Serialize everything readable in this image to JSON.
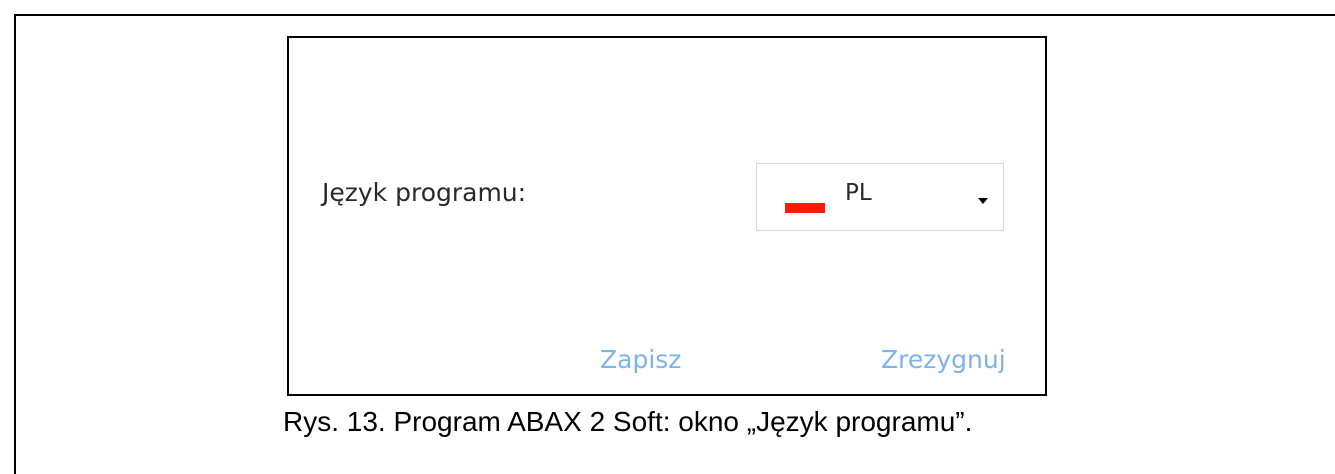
{
  "dialog": {
    "language_label": "Język programu:",
    "language_select": {
      "selected_value": "PL",
      "flag_icon": "poland-flag-icon",
      "flag_color": "#ff1a00",
      "dropdown_icon": "chevron-down-icon"
    },
    "save_label": "Zapisz",
    "cancel_label": "Zrezygnuj",
    "button_color": "#7eb3ea"
  },
  "caption": "Rys. 13. Program ABAX 2 Soft: okno „Język programu”."
}
